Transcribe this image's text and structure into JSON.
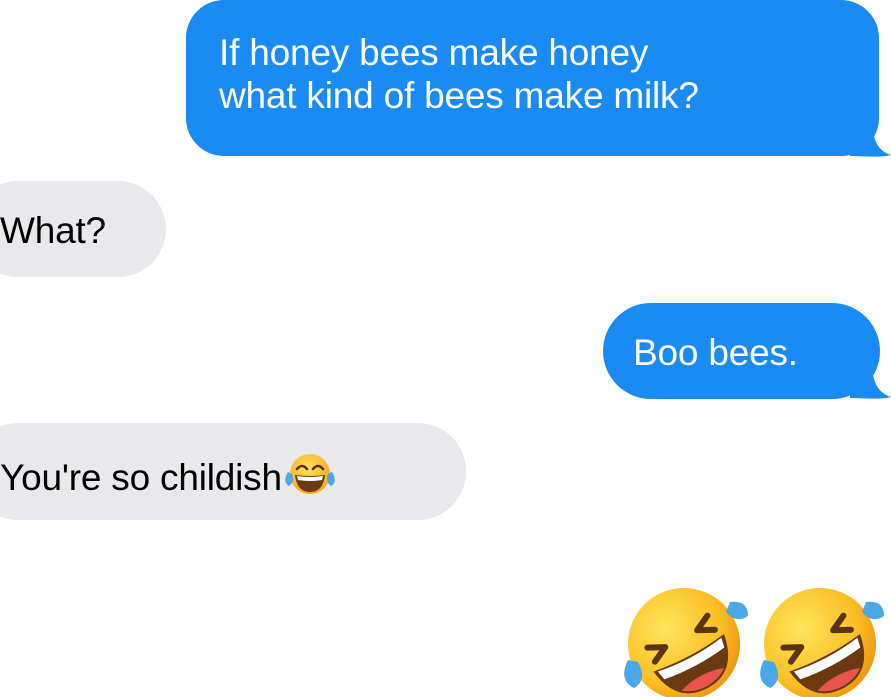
{
  "conversation": {
    "messages": [
      {
        "from": "me",
        "lines": [
          "If honey bees make honey",
          "what kind of bees make milk?"
        ]
      },
      {
        "from": "them",
        "text": "What?"
      },
      {
        "from": "me",
        "text": "Boo bees."
      },
      {
        "from": "them",
        "text": "You're so childish",
        "emoji": "face-with-tears-of-joy-icon"
      }
    ],
    "reactions": [
      "rolling-on-the-floor-laughing-icon",
      "rolling-on-the-floor-laughing-icon"
    ]
  },
  "colors": {
    "sent_bubble": "#1a8bf5",
    "received_bubble": "#e9e9eb",
    "sent_text": "#ffffff",
    "received_text": "#000000"
  }
}
